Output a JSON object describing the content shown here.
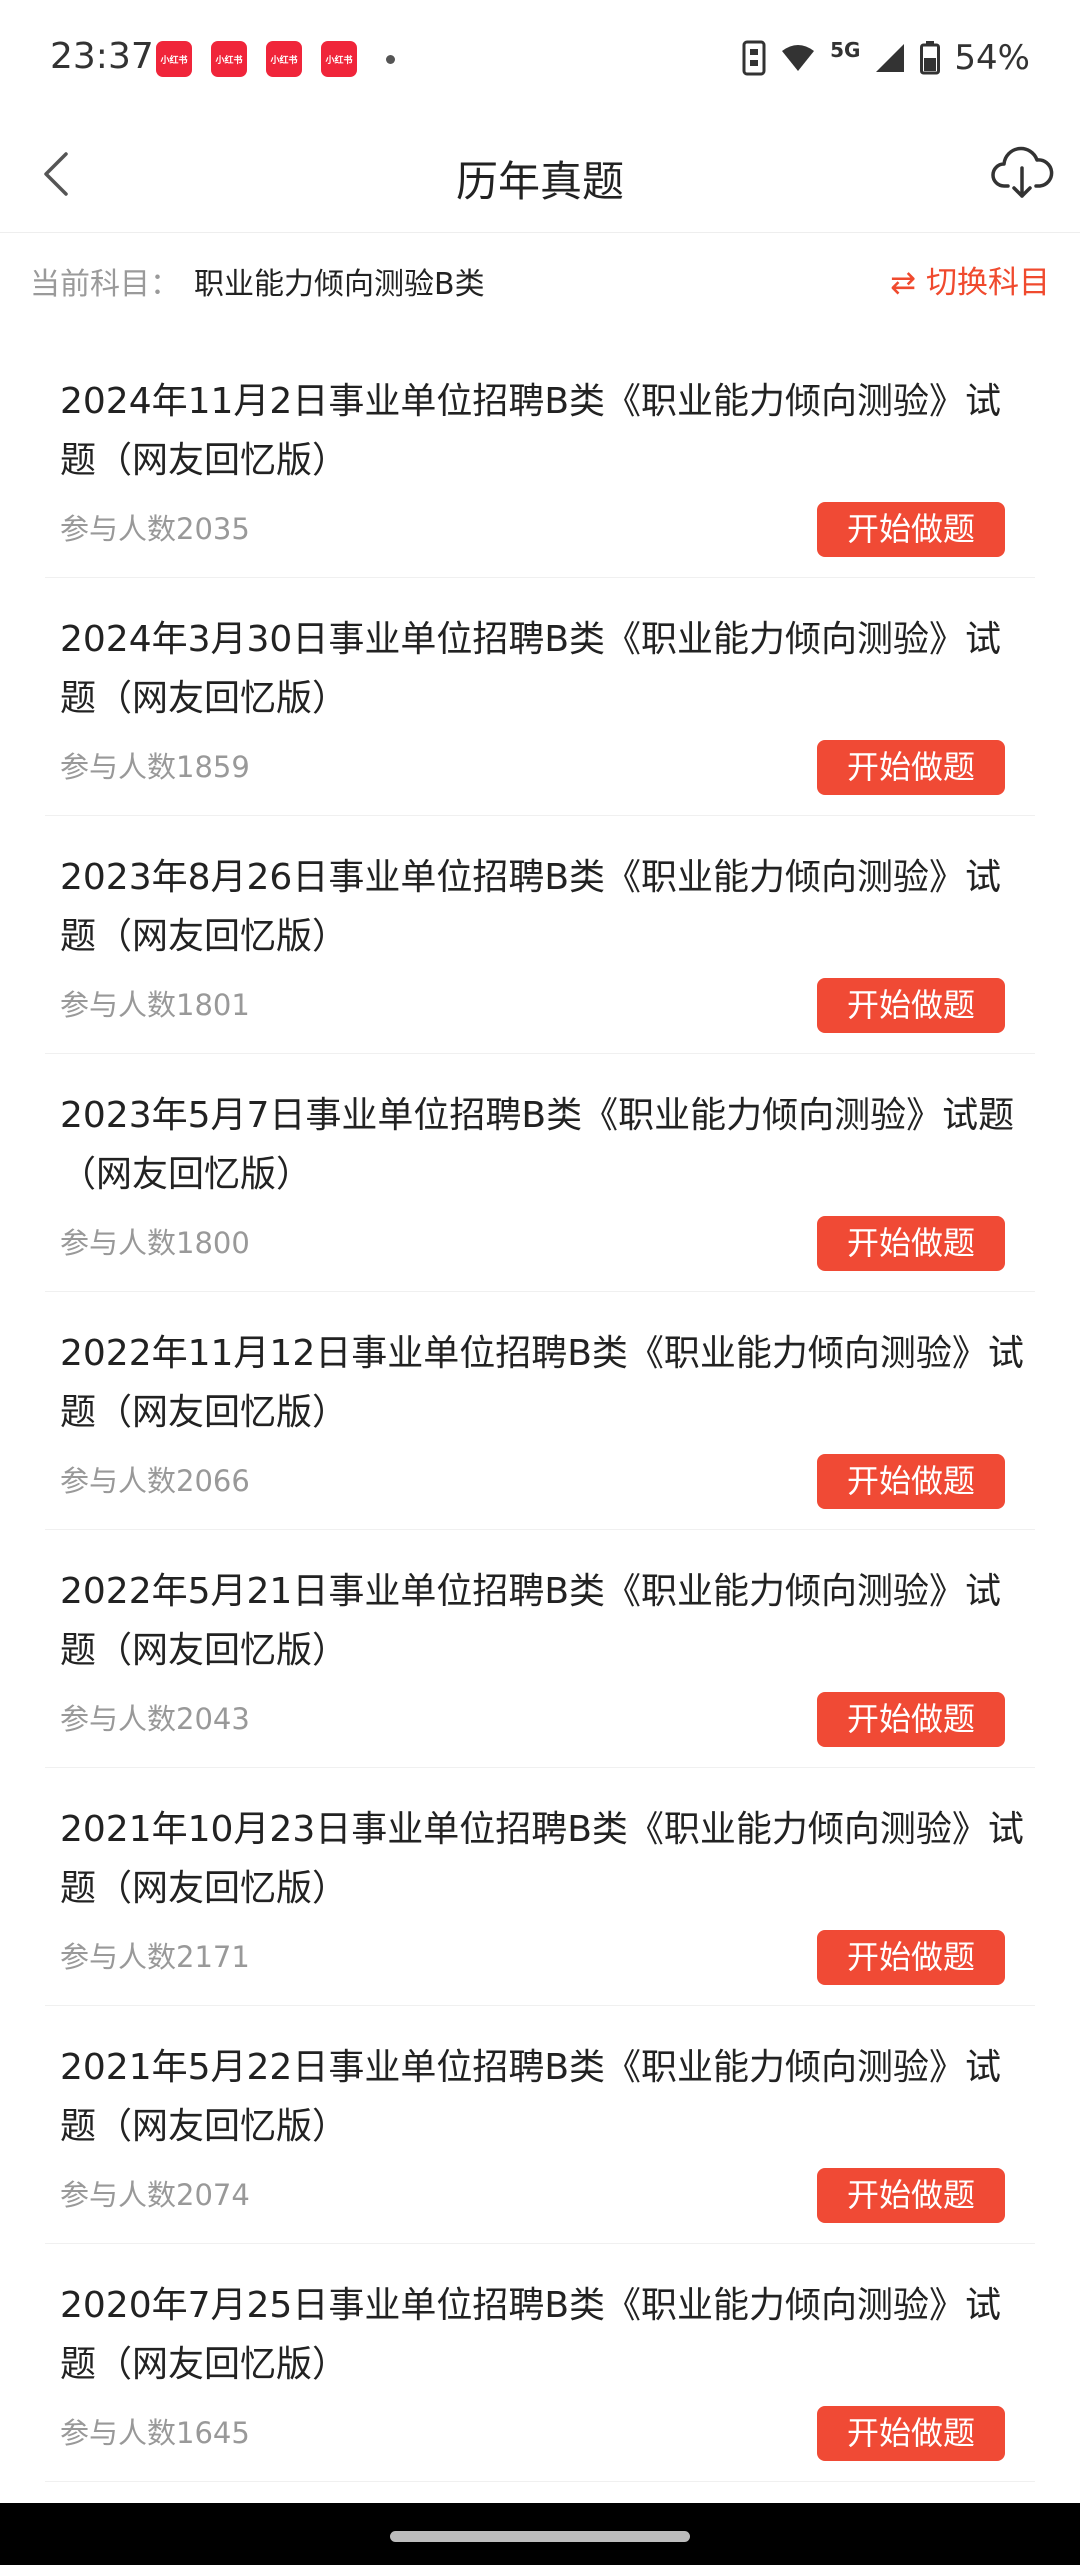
{
  "status_bar": {
    "time": "23:37",
    "app_icon_text": "小红书",
    "battery": "54%",
    "network": "5G",
    "icons": [
      "notification-app-icon",
      "nfc-icon",
      "wifi-icon",
      "signal-icon",
      "battery-icon"
    ]
  },
  "header": {
    "title": "历年真题",
    "back_icon": "back-arrow-icon",
    "download_icon": "cloud-download-icon"
  },
  "subject": {
    "label": "当前科目：",
    "value": "职业能力倾向测验B类",
    "switch_label": "⇄ 切换科目"
  },
  "exams": [
    {
      "title": "2024年11月2日事业单位招聘B类《职业能力倾向测验》试题（网友回忆版）",
      "participants": "参与人数2035",
      "button": "开始做题"
    },
    {
      "title": "2024年3月30日事业单位招聘B类《职业能力倾向测验》试题（网友回忆版）",
      "participants": "参与人数1859",
      "button": "开始做题"
    },
    {
      "title": "2023年8月26日事业单位招聘B类《职业能力倾向测验》试题（网友回忆版）",
      "participants": "参与人数1801",
      "button": "开始做题"
    },
    {
      "title": "2023年5月7日事业单位招聘B类《职业能力倾向测验》试题（网友回忆版）",
      "participants": "参与人数1800",
      "button": "开始做题"
    },
    {
      "title": "2022年11月12日事业单位招聘B类《职业能力倾向测验》试题（网友回忆版）",
      "participants": "参与人数2066",
      "button": "开始做题"
    },
    {
      "title": "2022年5月21日事业单位招聘B类《职业能力倾向测验》试题（网友回忆版）",
      "participants": "参与人数2043",
      "button": "开始做题"
    },
    {
      "title": "2021年10月23日事业单位招聘B类《职业能力倾向测验》试题（网友回忆版）",
      "participants": "参与人数2171",
      "button": "开始做题"
    },
    {
      "title": "2021年5月22日事业单位招聘B类《职业能力倾向测验》试题（网友回忆版）",
      "participants": "参与人数2074",
      "button": "开始做题"
    },
    {
      "title": "2020年7月25日事业单位招聘B类《职业能力倾向测验》试题（网友回忆版）",
      "participants": "参与人数1645",
      "button": "开始做题"
    }
  ],
  "colors": {
    "accent": "#f04a35",
    "muted_text": "#999999",
    "primary_text": "#222222"
  }
}
